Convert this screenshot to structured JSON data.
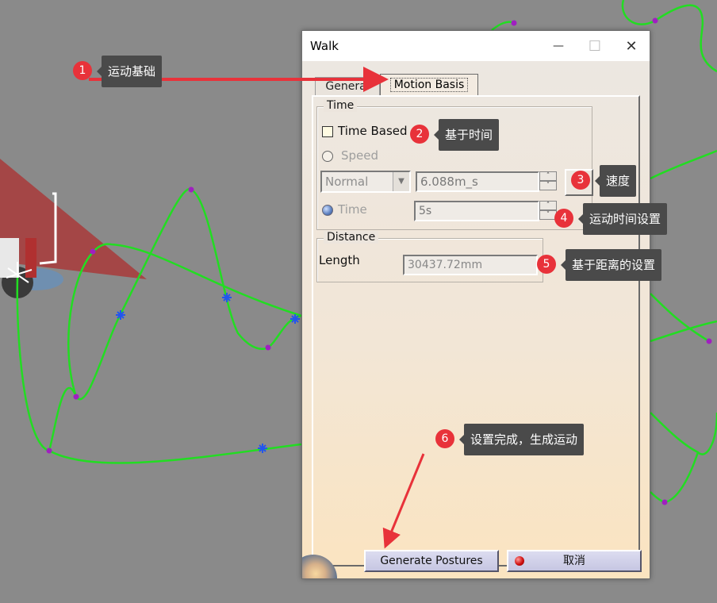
{
  "dialog": {
    "title": "Walk",
    "minimize_glyph": "—",
    "maximize_glyph": "☐",
    "close_glyph": "✕"
  },
  "tabs": [
    "General",
    "Motion Basis"
  ],
  "time_group": {
    "title": "Time",
    "time_based_label": "Time Based",
    "speed_label": "Speed",
    "speed_select": "Normal",
    "speed_value": "6.088m_s",
    "time_label": "Time",
    "time_value": "5s"
  },
  "distance_group": {
    "title": "Distance",
    "length_label": "Length",
    "length_value": "30437.72mm"
  },
  "buttons": {
    "generate": "Generate Postures",
    "cancel": "取消"
  },
  "annotations": [
    {
      "num": "1",
      "text": "运动基础"
    },
    {
      "num": "2",
      "text": "基于时间"
    },
    {
      "num": "3",
      "text": "速度"
    },
    {
      "num": "4",
      "text": "运动时间设置"
    },
    {
      "num": "5",
      "text": "基于距离的设置"
    },
    {
      "num": "6",
      "text": "设置完成，生成运动"
    }
  ],
  "colors": {
    "background": "#8a8a8a",
    "path": "#22dd22",
    "path_points": "#a020c0",
    "star_markers": "#2255ee",
    "callout": "#4a4a4a",
    "badge": "#e8323a",
    "arrow": "#e8323a"
  }
}
